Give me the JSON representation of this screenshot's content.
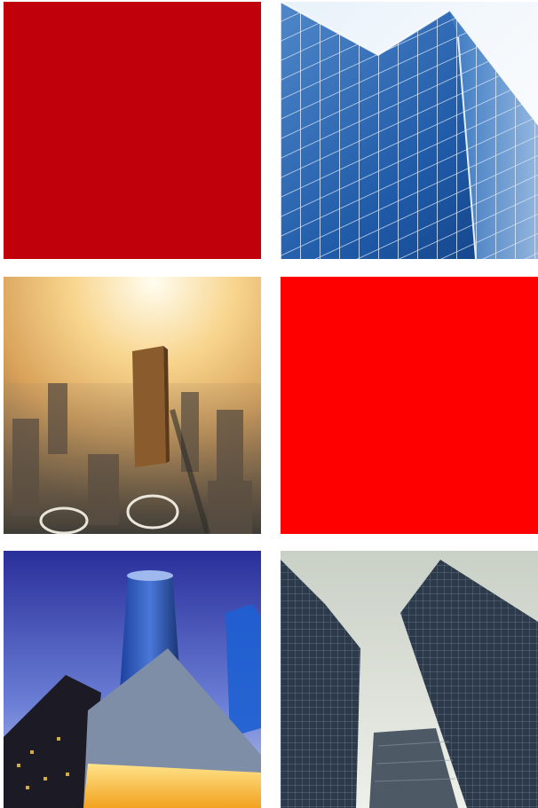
{
  "tiles": [
    {
      "kind": "color-block",
      "color": "#c0000a"
    },
    {
      "kind": "photo",
      "subject": "glass-office-facade"
    },
    {
      "kind": "photo",
      "subject": "sunlit-city-aerial"
    },
    {
      "kind": "color-block",
      "color": "#ff0000"
    },
    {
      "kind": "photo",
      "subject": "night-skyscrapers-looking-up"
    },
    {
      "kind": "photo",
      "subject": "grey-towers-looking-up"
    }
  ]
}
